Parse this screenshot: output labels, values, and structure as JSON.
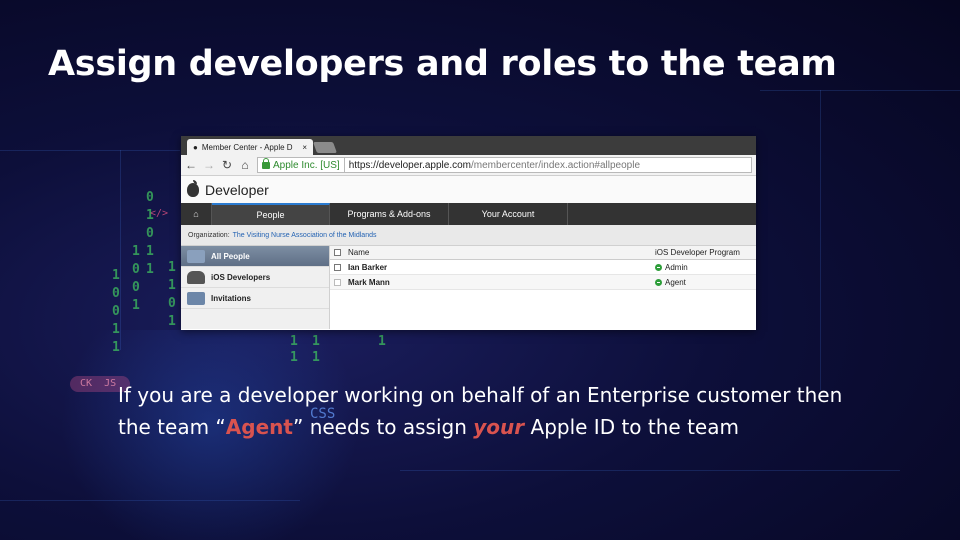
{
  "slide": {
    "title": "Assign developers and roles to the team",
    "body": {
      "line1": "If you are a developer working on behalf of an Enterprise customer then",
      "line2_pre": "the team “",
      "line2_agent": "Agent",
      "line2_mid": "” needs to assign ",
      "line2_your": "your",
      "line2_post": " Apple ID to the team"
    },
    "highlight_color": "#d9534f"
  },
  "browser": {
    "tab_title": "Member Center - Apple D",
    "tab_close": "×",
    "ev_label": "Apple Inc. [US]",
    "url_main": "https://developer.apple.com",
    "url_rest": "/membercenter/index.action#allpeople"
  },
  "page": {
    "brand": "Developer",
    "nav": {
      "people": "People",
      "programs": "Programs & Add-ons",
      "account": "Your Account"
    },
    "org_label": "Organization:",
    "org_name": "The Visiting Nurse Association of the Midlands",
    "sidebar": [
      {
        "label": "All People",
        "active": true
      },
      {
        "label": "iOS Developers",
        "active": false
      },
      {
        "label": "Invitations",
        "active": false
      }
    ],
    "table": {
      "headers": {
        "name": "Name",
        "program": "iOS Developer Program"
      },
      "rows": [
        {
          "name": "Ian Barker",
          "role": "Admin"
        },
        {
          "name": "Mark Mann",
          "role": "Agent"
        }
      ],
      "role_color": "#2e9e3a"
    }
  }
}
